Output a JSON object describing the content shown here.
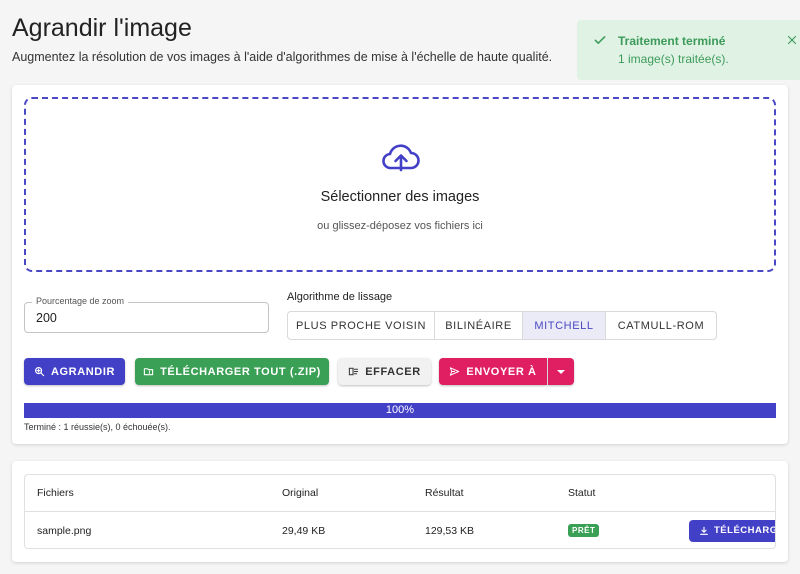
{
  "header": {
    "title": "Agrandir l'image",
    "subtitle": "Augmentez la résolution de vos images à l'aide d'algorithmes de mise à l'échelle de haute qualité."
  },
  "toast": {
    "title": "Traitement terminé",
    "message": "1 image(s) traitée(s).",
    "check_icon": "check-icon",
    "close_icon": "close-icon",
    "color": "#3d9b5a",
    "background": "#dff2e3"
  },
  "dropzone": {
    "icon": "cloud-upload-icon",
    "title": "Sélectionner des images",
    "subtitle": "ou glissez-déposez vos fichiers ici"
  },
  "zoom": {
    "label": "Pourcentage de zoom",
    "value": "200"
  },
  "algorithm": {
    "label": "Algorithme de lissage",
    "options": [
      "Plus proche voisin",
      "Bilinéaire",
      "Mitchell",
      "Catmull-Rom"
    ],
    "selected": "Mitchell"
  },
  "actions": {
    "grow": "Agrandir",
    "download_zip": "Télécharger tout (.zip)",
    "clear": "Effacer",
    "send": "Envoyer à"
  },
  "progress": {
    "percent": 100,
    "label": "100%",
    "status": "Terminé : 1 réussie(s), 0 échouée(s)."
  },
  "table": {
    "columns": [
      "Fichiers",
      "Original",
      "Résultat",
      "Statut",
      ""
    ],
    "rows": [
      {
        "file": "sample.png",
        "original": "29,49 KB",
        "result": "129,53 KB",
        "status": "Prêt",
        "action": "Télécharger"
      }
    ]
  },
  "colors": {
    "primary": "#4340c8",
    "success": "#3aa055",
    "accent": "#e01f63"
  }
}
